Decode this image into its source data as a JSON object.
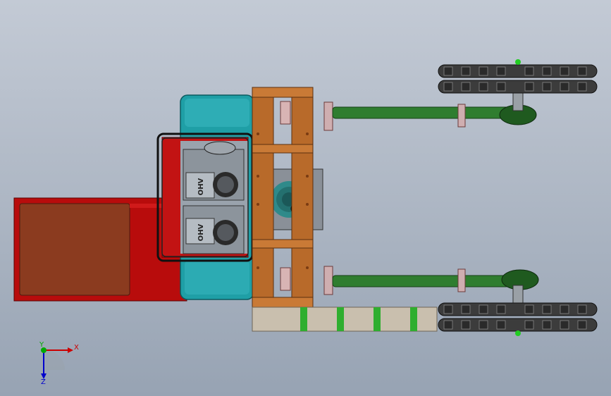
{
  "view": {
    "background_top": "#c3cad5",
    "background_bottom": "#97a3b3"
  },
  "triad": {
    "x_label": "X",
    "y_label": "Y",
    "z_label": "Z",
    "x_color": "#cc0000",
    "y_color": "#00aa00",
    "z_color": "#0000cc"
  },
  "engine": {
    "left_logo": "OHV",
    "right_logo": "OHV"
  },
  "colors": {
    "frame_red": "#b80c0c",
    "panel_brown": "#8b3b1f",
    "housing_teal": "#1f9fa6",
    "plate_orange": "#b86a2a",
    "shaft_green": "#2f7d2f",
    "base_beige": "#c9bfae",
    "track_gray": "#3c3c3c"
  }
}
